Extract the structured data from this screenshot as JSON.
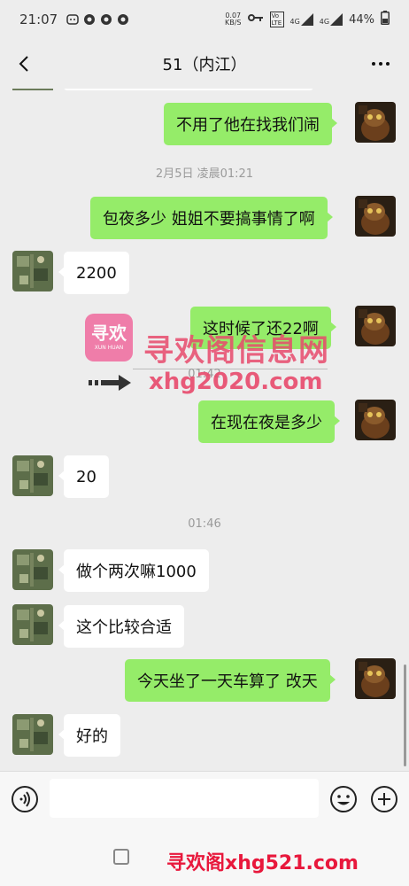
{
  "status_bar": {
    "time": "21:07",
    "net_speed_top": "0.07",
    "net_speed_bottom": "KB/S",
    "volte": "Vo LTE",
    "signal1": "4G",
    "signal2": "4G",
    "battery": "44%"
  },
  "header": {
    "title": "51（内江）"
  },
  "messages": [
    {
      "side": "me",
      "text": "不用了他在找我们闹"
    },
    {
      "timestamp": "2月5日 凌晨01:21"
    },
    {
      "side": "me",
      "text": "包夜多少 姐姐不要搞事情了啊"
    },
    {
      "side": "other",
      "text": "2200"
    },
    {
      "side": "me",
      "text": "这时候了还22啊"
    },
    {
      "timestamp": "01:42"
    },
    {
      "side": "me",
      "text": "在现在夜是多少"
    },
    {
      "side": "other",
      "text": "20"
    },
    {
      "timestamp": "01:46"
    },
    {
      "side": "other",
      "text": "做个两次嘛1000"
    },
    {
      "side": "other",
      "text": "这个比较合适"
    },
    {
      "side": "me",
      "text": "今天坐了一天车算了 改天"
    },
    {
      "side": "other",
      "text": "好的"
    }
  ],
  "watermark": {
    "logo_text": "寻欢",
    "logo_sub": "XUN HUAN",
    "main": "寻欢阁信息网",
    "url": "xhg2020.com",
    "bottom": "寻欢阁xhg521.com"
  },
  "input": {
    "placeholder": ""
  },
  "colors": {
    "me_bubble": "#95ec69",
    "other_bubble": "#ffffff",
    "background": "#ededed",
    "watermark": "#e84a6c"
  }
}
